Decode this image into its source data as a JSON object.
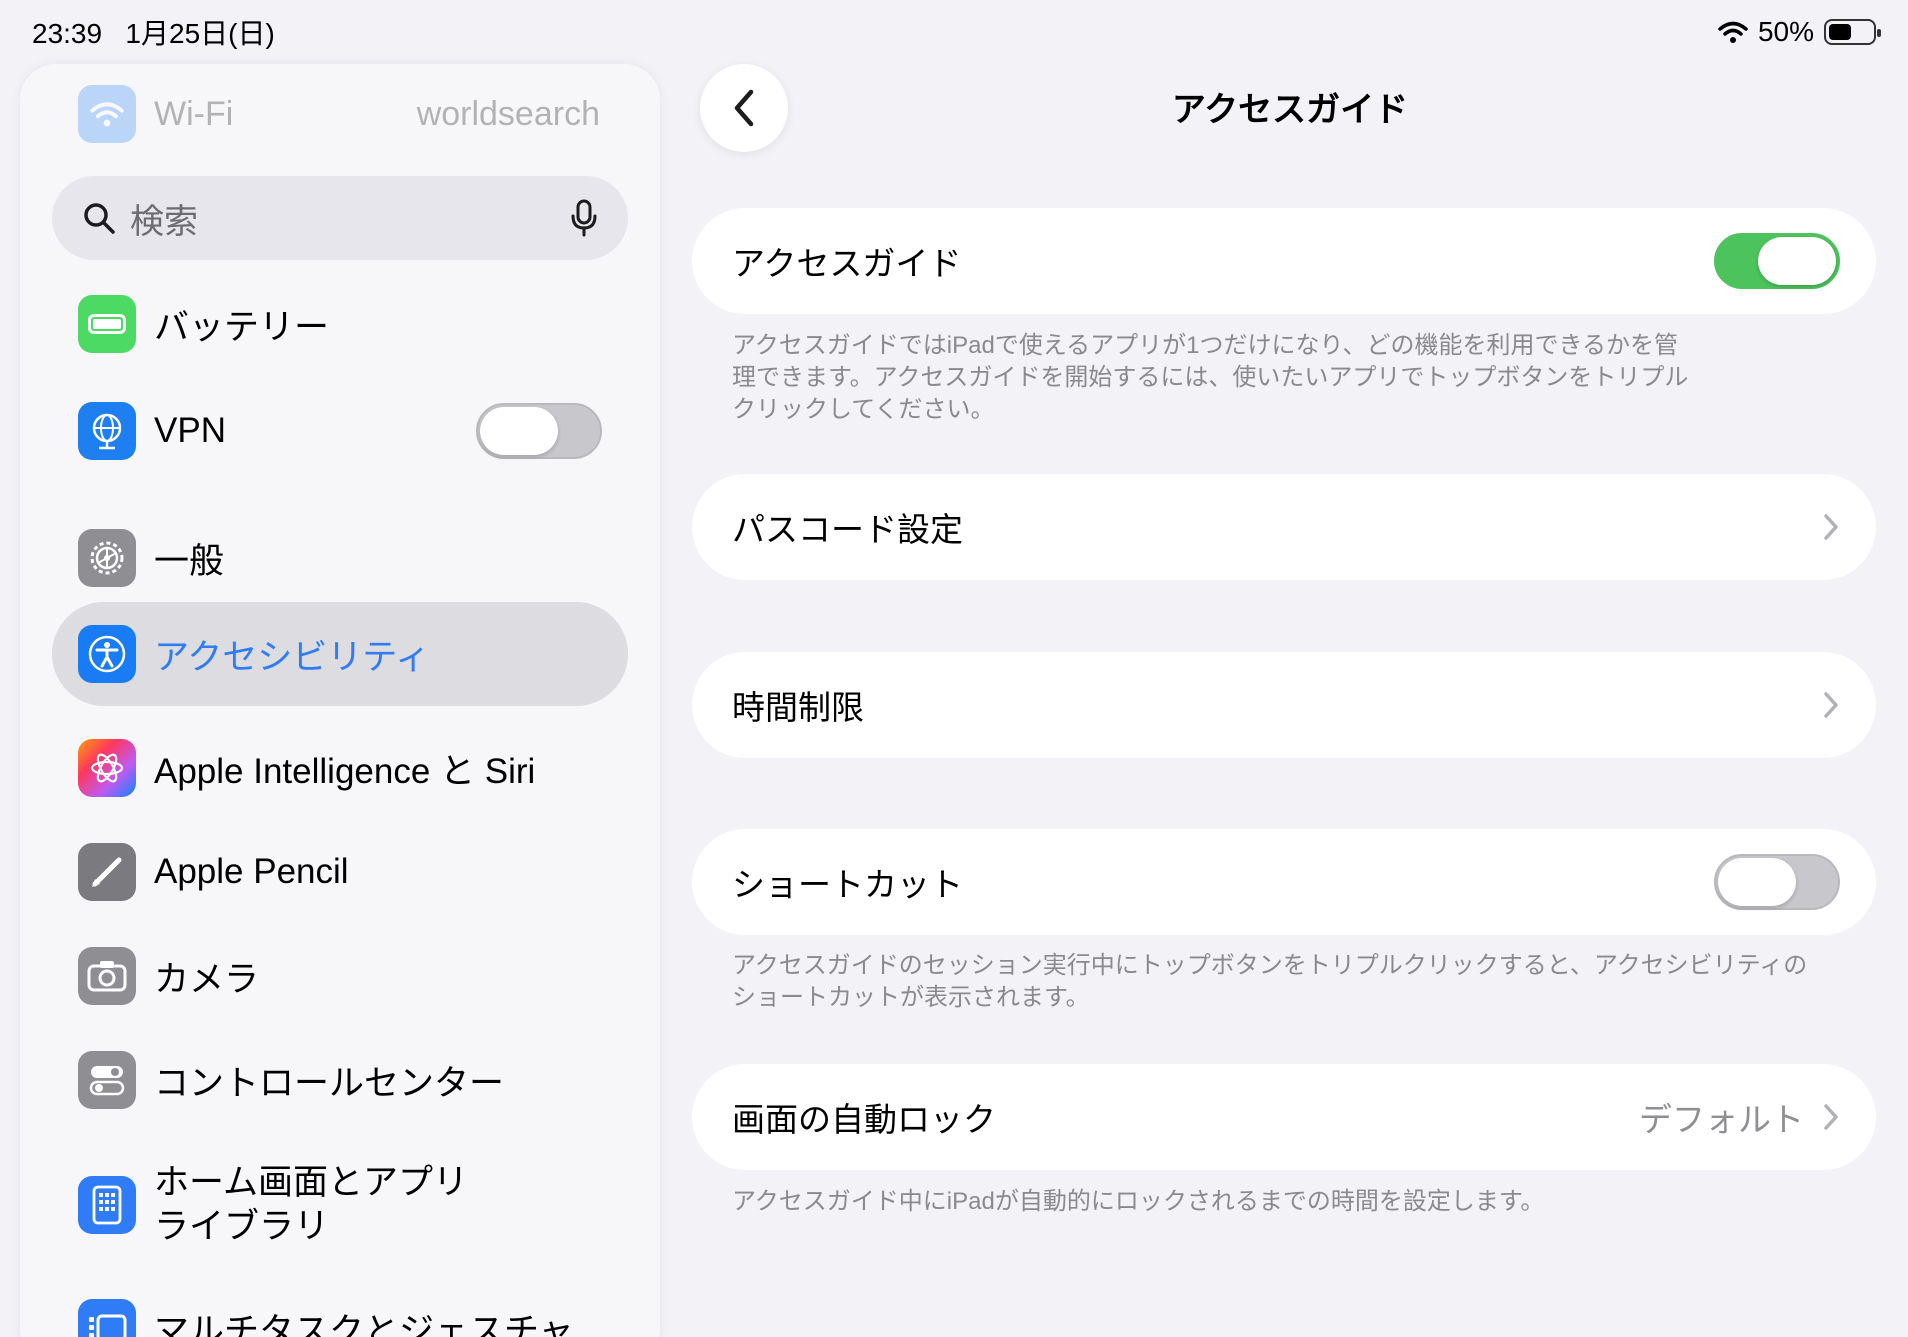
{
  "status_bar": {
    "time": "23:39",
    "date": "1月25日(日)",
    "battery": "50%"
  },
  "sidebar": {
    "wifi": {
      "label": "Wi-Fi",
      "value": "worldsearch"
    },
    "search_placeholder": "検索",
    "items": [
      {
        "label": "バッテリー",
        "icon": "battery-icon",
        "color": "#4cd964"
      },
      {
        "label": "VPN",
        "icon": "globe-icon",
        "color": "#1e7ff0",
        "toggle": false
      },
      {
        "label": "一般",
        "icon": "gear-icon",
        "color": "#8e8e93"
      },
      {
        "label": "アクセシビリティ",
        "icon": "accessibility-icon",
        "color": "#1a7cf5",
        "selected": true
      },
      {
        "label": "Apple Intelligence と Siri",
        "icon": "apple-intelligence-icon",
        "color": "#f08bb6"
      },
      {
        "label": "Apple Pencil",
        "icon": "pencil-icon",
        "color": "#7a7a7f"
      },
      {
        "label": "カメラ",
        "icon": "camera-icon",
        "color": "#8e8e93"
      },
      {
        "label": "コントロールセンター",
        "icon": "control-center-icon",
        "color": "#8e8e93"
      },
      {
        "label": "ホーム画面とアプリライブラリ",
        "line1": "ホーム画面とアプリ",
        "line2": "ライブラリ",
        "icon": "home-screen-icon",
        "color": "#2f7cf6"
      },
      {
        "label": "マルチタスクとジェスチャ",
        "icon": "multitasking-icon",
        "color": "#2f7cf6"
      }
    ]
  },
  "header": {
    "title": "アクセスガイド"
  },
  "main": {
    "guided_access": {
      "label": "アクセスガイド",
      "toggle": true
    },
    "guided_access_footer": [
      "アクセスガイドではiPadで使えるアプリが1つだけになり、どの機能を利用できるかを管",
      "理できます。アクセスガイドを開始するには、使いたいアプリでトップボタンをトリプル",
      "クリックしてください。"
    ],
    "passcode": {
      "label": "パスコード設定"
    },
    "time_limits": {
      "label": "時間制限"
    },
    "shortcut": {
      "label": "ショートカット",
      "toggle": false
    },
    "shortcut_footer": [
      "アクセスガイドのセッション実行中にトップボタンをトリプルクリックすると、アクセシビリティの",
      "ショートカットが表示されます。"
    ],
    "auto_lock": {
      "label": "画面の自動ロック",
      "value": "デフォルト"
    },
    "auto_lock_footer": "アクセスガイド中にiPadが自動的にロックされるまでの時間を設定します。"
  }
}
